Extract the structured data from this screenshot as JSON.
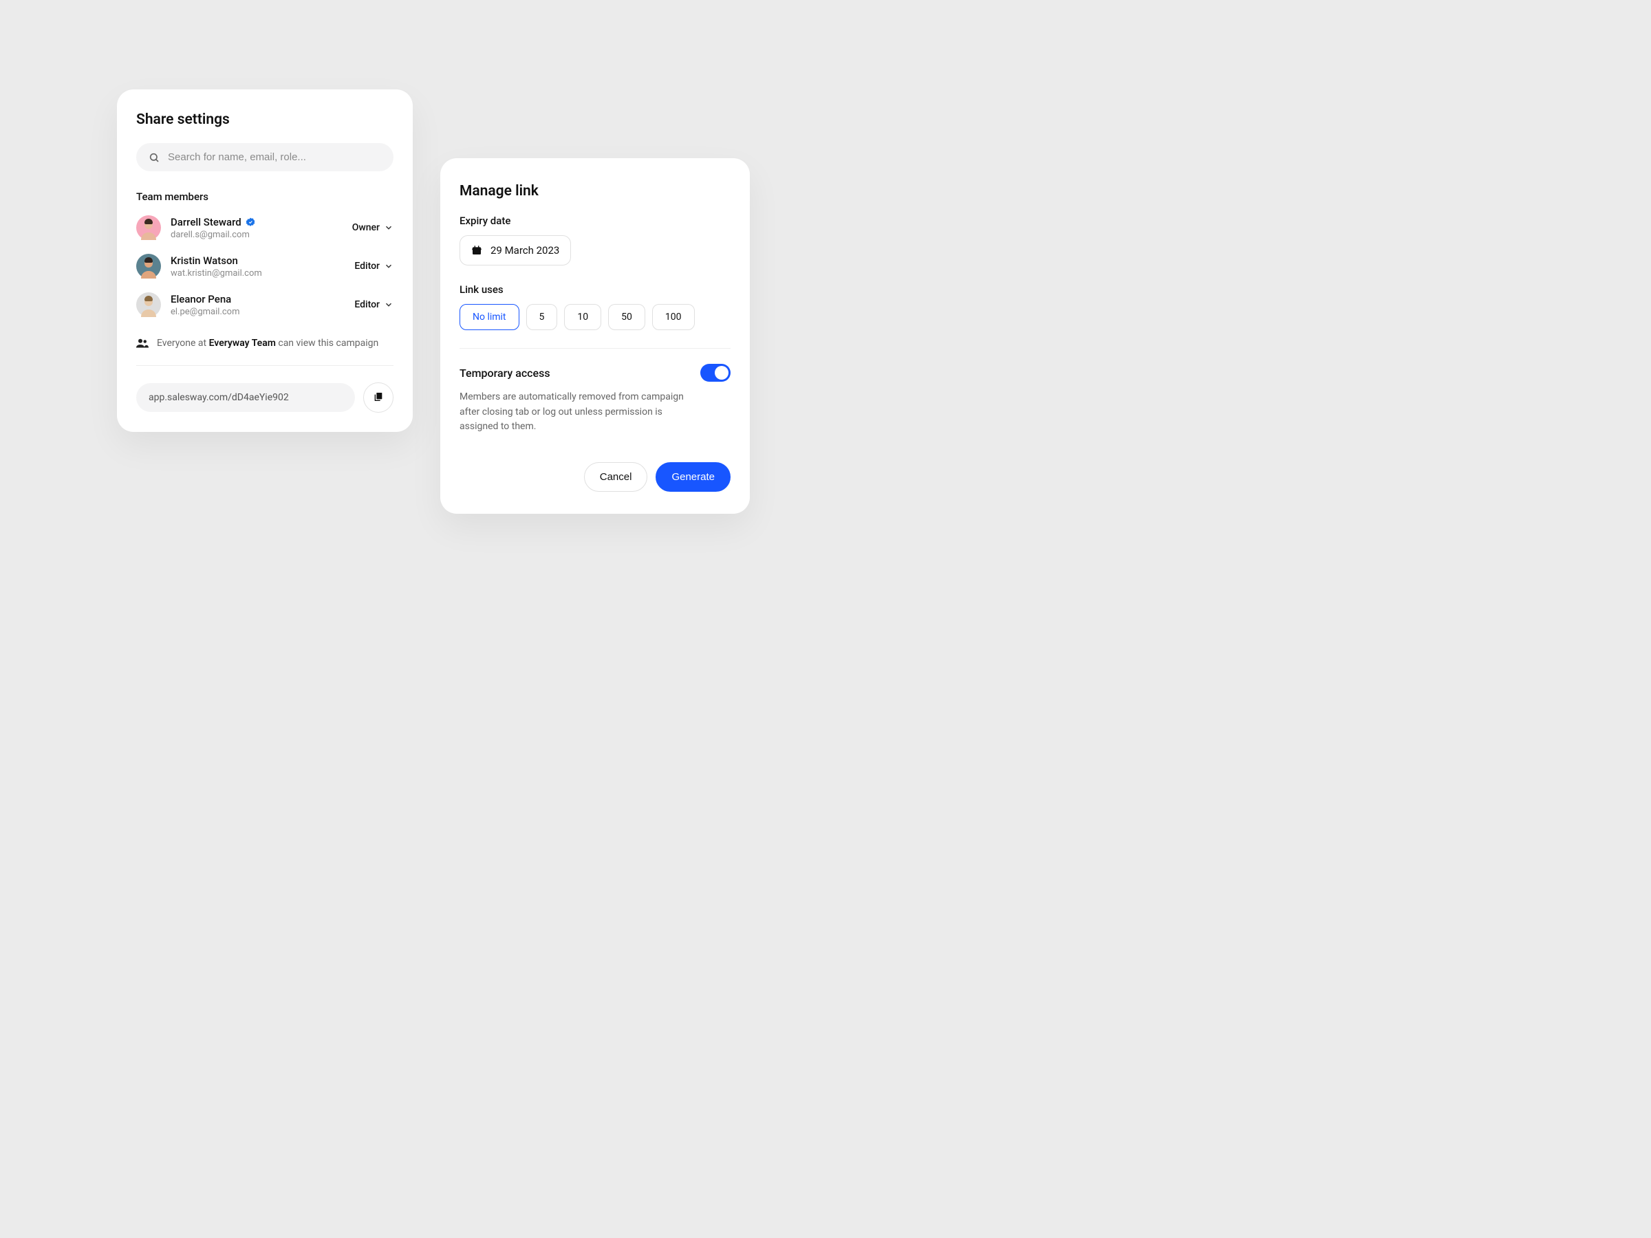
{
  "share": {
    "title": "Share settings",
    "search_placeholder": "Search for name, email, role...",
    "team_label": "Team members",
    "members": [
      {
        "name": "Darrell Steward",
        "email": "darell.s@gmail.com",
        "role": "Owner",
        "verified": true,
        "avatar_bg": "#f7a6b9"
      },
      {
        "name": "Kristin Watson",
        "email": "wat.kristin@gmail.com",
        "role": "Editor",
        "verified": false,
        "avatar_bg": "#5a8290"
      },
      {
        "name": "Eleanor Pena",
        "email": "el.pe@gmail.com",
        "role": "Editor",
        "verified": false,
        "avatar_bg": "#dedede"
      }
    ],
    "access_prefix": "Everyone at ",
    "access_team": "Everyway Team",
    "access_suffix": " can view this campaign",
    "link_url": "app.salesway.com/dD4aeYie902"
  },
  "manage": {
    "title": "Manage link",
    "expiry_label": "Expiry date",
    "expiry_value": "29 March 2023",
    "link_uses_label": "Link uses",
    "link_uses": [
      "No limit",
      "5",
      "10",
      "50",
      "100"
    ],
    "link_uses_selected": "No limit",
    "temp_title": "Temporary access",
    "temp_desc": "Members are automatically removed from campaign after closing tab or log out unless permission is assigned to them.",
    "temp_enabled": true,
    "cancel_label": "Cancel",
    "generate_label": "Generate"
  }
}
